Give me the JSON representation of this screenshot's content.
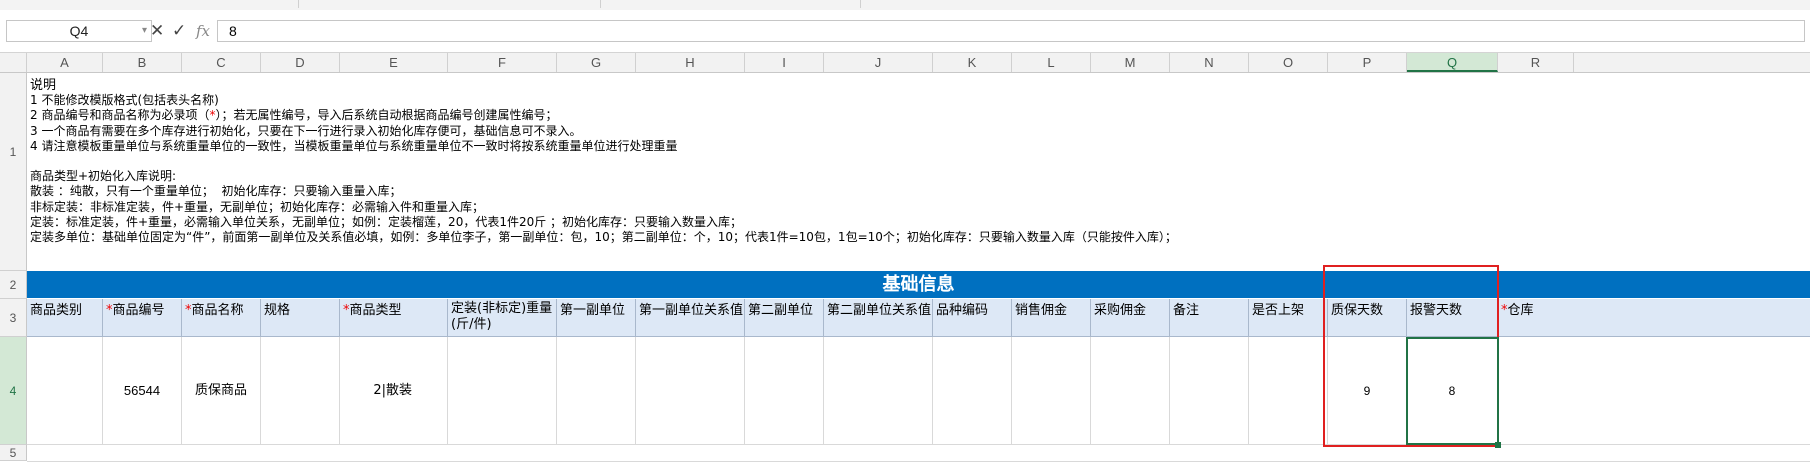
{
  "formula_bar": {
    "name_box": "Q4",
    "cancel_icon": "✕",
    "confirm_icon": "✓",
    "fx_label": "fx",
    "value": "8"
  },
  "columns": [
    "A",
    "B",
    "C",
    "D",
    "E",
    "F",
    "G",
    "H",
    "I",
    "J",
    "K",
    "L",
    "M",
    "N",
    "O",
    "P",
    "Q",
    "R"
  ],
  "selected_column": "Q",
  "rows": [
    "1",
    "2",
    "3",
    "4",
    "5"
  ],
  "selected_row": "4",
  "notes": {
    "title": "说明",
    "line1": "1 不能修改模版格式(包括表头名称)",
    "line2_a": "2 商品编号和商品名称为必录项（",
    "line2_star": "*",
    "line2_b": "）；若无属性编号，导入后系统自动根据商品编号创建属性编号；",
    "line3": "3 一个商品有需要在多个库存进行初始化，只要在下一行进行录入初始化库存便可，基础信息可不录入。",
    "line4": "4 请注意模板重量单位与系统重量单位的一致性，当模板重量单位与系统重量单位不一致时将按系统重量单位进行处理重量",
    "type_title": "商品类型+初始化入库说明:",
    "type1": "散装 ：纯散，只有一个重量单位；  初始化库存：只要输入重量入库；",
    "type2": "非标定装：非标准定装，件+重量，无副单位；初始化库存：必需输入件和重量入库；",
    "type3": "定装：标准定装，件+重量，必需输入单位关系，无副单位；如例：定装榴莲，20，代表1件20斤 ；初始化库存：只要输入数量入库；",
    "type4": "定装多单位：基础单位固定为“件”，前面第一副单位及关系值必填，如例：多单位李子，第一副单位：包，10；第二副单位：个，10；代表1件=10包，1包=10个；初始化库存：只要输入数量入库（只能按件入库）；"
  },
  "banner_title": "基础信息",
  "headers": [
    {
      "label": "商品类别",
      "required": false
    },
    {
      "label": "商品编号",
      "required": true
    },
    {
      "label": "商品名称",
      "required": true
    },
    {
      "label": "规格",
      "required": false
    },
    {
      "label": "商品类型",
      "required": true
    },
    {
      "label": "定装(非标定)重量\n(斤/件)",
      "required": false
    },
    {
      "label": "第一副单位",
      "required": false
    },
    {
      "label": "第一副单位关系值",
      "required": false
    },
    {
      "label": "第二副单位",
      "required": false
    },
    {
      "label": "第二副单位关系值",
      "required": false
    },
    {
      "label": "品种编码",
      "required": false
    },
    {
      "label": "销售佣金",
      "required": false
    },
    {
      "label": "采购佣金",
      "required": false
    },
    {
      "label": "备注",
      "required": false
    },
    {
      "label": "是否上架",
      "required": false
    },
    {
      "label": "质保天数",
      "required": false
    },
    {
      "label": "报警天数",
      "required": false
    },
    {
      "label": "仓库",
      "required": true
    }
  ],
  "data_row": [
    "",
    "56544",
    "质保商品",
    "",
    "2|散装",
    "",
    "",
    "",
    "",
    "",
    "",
    "",
    "",
    "",
    "",
    "9",
    "8",
    ""
  ],
  "colors": {
    "banner": "#0070c0",
    "header_fill": "#dde8f6",
    "selection": "#217346",
    "highlight_box": "#e02020"
  }
}
